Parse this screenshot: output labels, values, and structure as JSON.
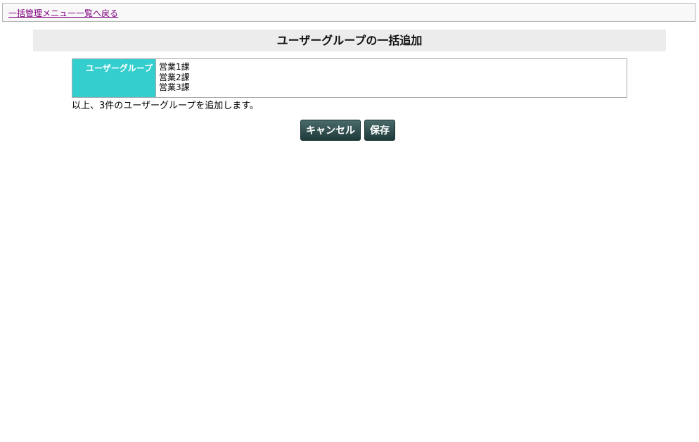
{
  "nav": {
    "back_link": "一括管理メニュー一覧へ戻る"
  },
  "page": {
    "title": "ユーザーグループの一括追加"
  },
  "table": {
    "label": "ユーザーグループ",
    "groups": [
      "営業1課",
      "営業2課",
      "営業3課"
    ]
  },
  "summary": "以上、3件のユーザーグループを追加します。",
  "buttons": {
    "cancel": "キャンセル",
    "save": "保存"
  },
  "colors": {
    "label_cell_bg": "#35cece",
    "button_bg": "#2f4d4d",
    "link": "#800080"
  }
}
